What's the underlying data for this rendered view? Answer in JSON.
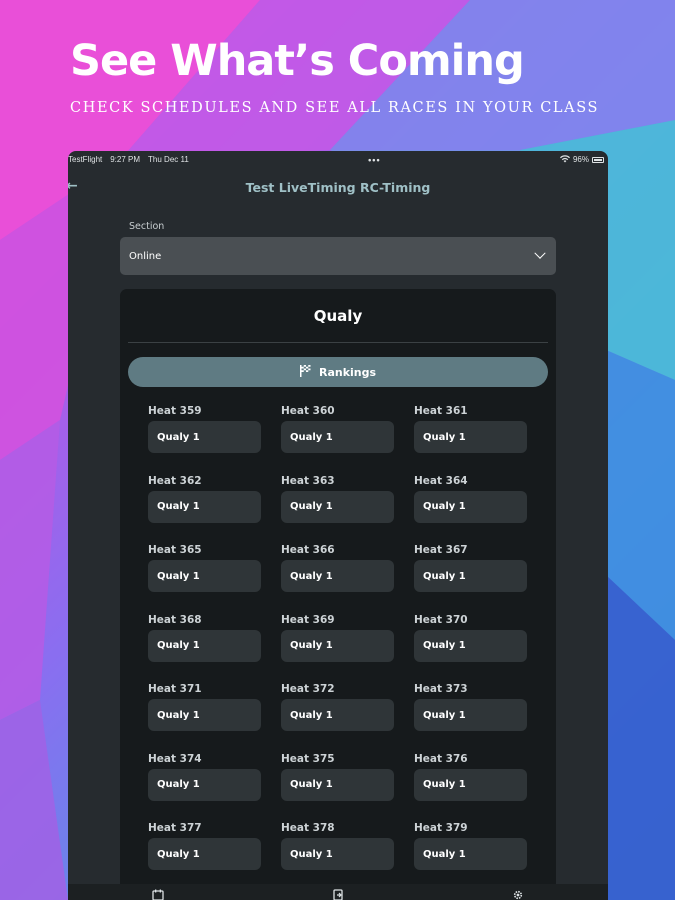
{
  "promo": {
    "headline": "See What’s Coming",
    "subhead": "CHECK SCHEDULES AND SEE ALL RACES IN YOUR CLASS"
  },
  "status": {
    "carrier": "TestFlight",
    "time": "9:27 PM",
    "date": "Thu Dec 11",
    "battery": "96%"
  },
  "appbar": {
    "title": "Test LiveTiming RC-Timing"
  },
  "section": {
    "label": "Section",
    "value": "Online"
  },
  "card": {
    "title": "Qualy",
    "rankings_label": "Rankings"
  },
  "heats": [
    {
      "name": "Heat 359",
      "round": "Qualy 1"
    },
    {
      "name": "Heat 360",
      "round": "Qualy 1"
    },
    {
      "name": "Heat 361",
      "round": "Qualy 1"
    },
    {
      "name": "Heat 362",
      "round": "Qualy 1"
    },
    {
      "name": "Heat 363",
      "round": "Qualy 1"
    },
    {
      "name": "Heat 364",
      "round": "Qualy 1"
    },
    {
      "name": "Heat 365",
      "round": "Qualy 1"
    },
    {
      "name": "Heat 366",
      "round": "Qualy 1"
    },
    {
      "name": "Heat 367",
      "round": "Qualy 1"
    },
    {
      "name": "Heat 368",
      "round": "Qualy 1"
    },
    {
      "name": "Heat 369",
      "round": "Qualy 1"
    },
    {
      "name": "Heat 370",
      "round": "Qualy 1"
    },
    {
      "name": "Heat 371",
      "round": "Qualy 1"
    },
    {
      "name": "Heat 372",
      "round": "Qualy 1"
    },
    {
      "name": "Heat 373",
      "round": "Qualy 1"
    },
    {
      "name": "Heat 374",
      "round": "Qualy 1"
    },
    {
      "name": "Heat 375",
      "round": "Qualy 1"
    },
    {
      "name": "Heat 376",
      "round": "Qualy 1"
    },
    {
      "name": "Heat 377",
      "round": "Qualy 1"
    },
    {
      "name": "Heat 378",
      "round": "Qualy 1"
    },
    {
      "name": "Heat 379",
      "round": "Qualy 1"
    }
  ],
  "icons": {
    "back": "back-arrow-icon",
    "chevron": "chevron-down-icon",
    "flag": "checkered-flag-icon",
    "wifi": "wifi-icon",
    "battery": "battery-icon",
    "tab_schedule": "calendar-icon",
    "tab_results": "document-icon",
    "tab_settings": "gear-icon"
  }
}
